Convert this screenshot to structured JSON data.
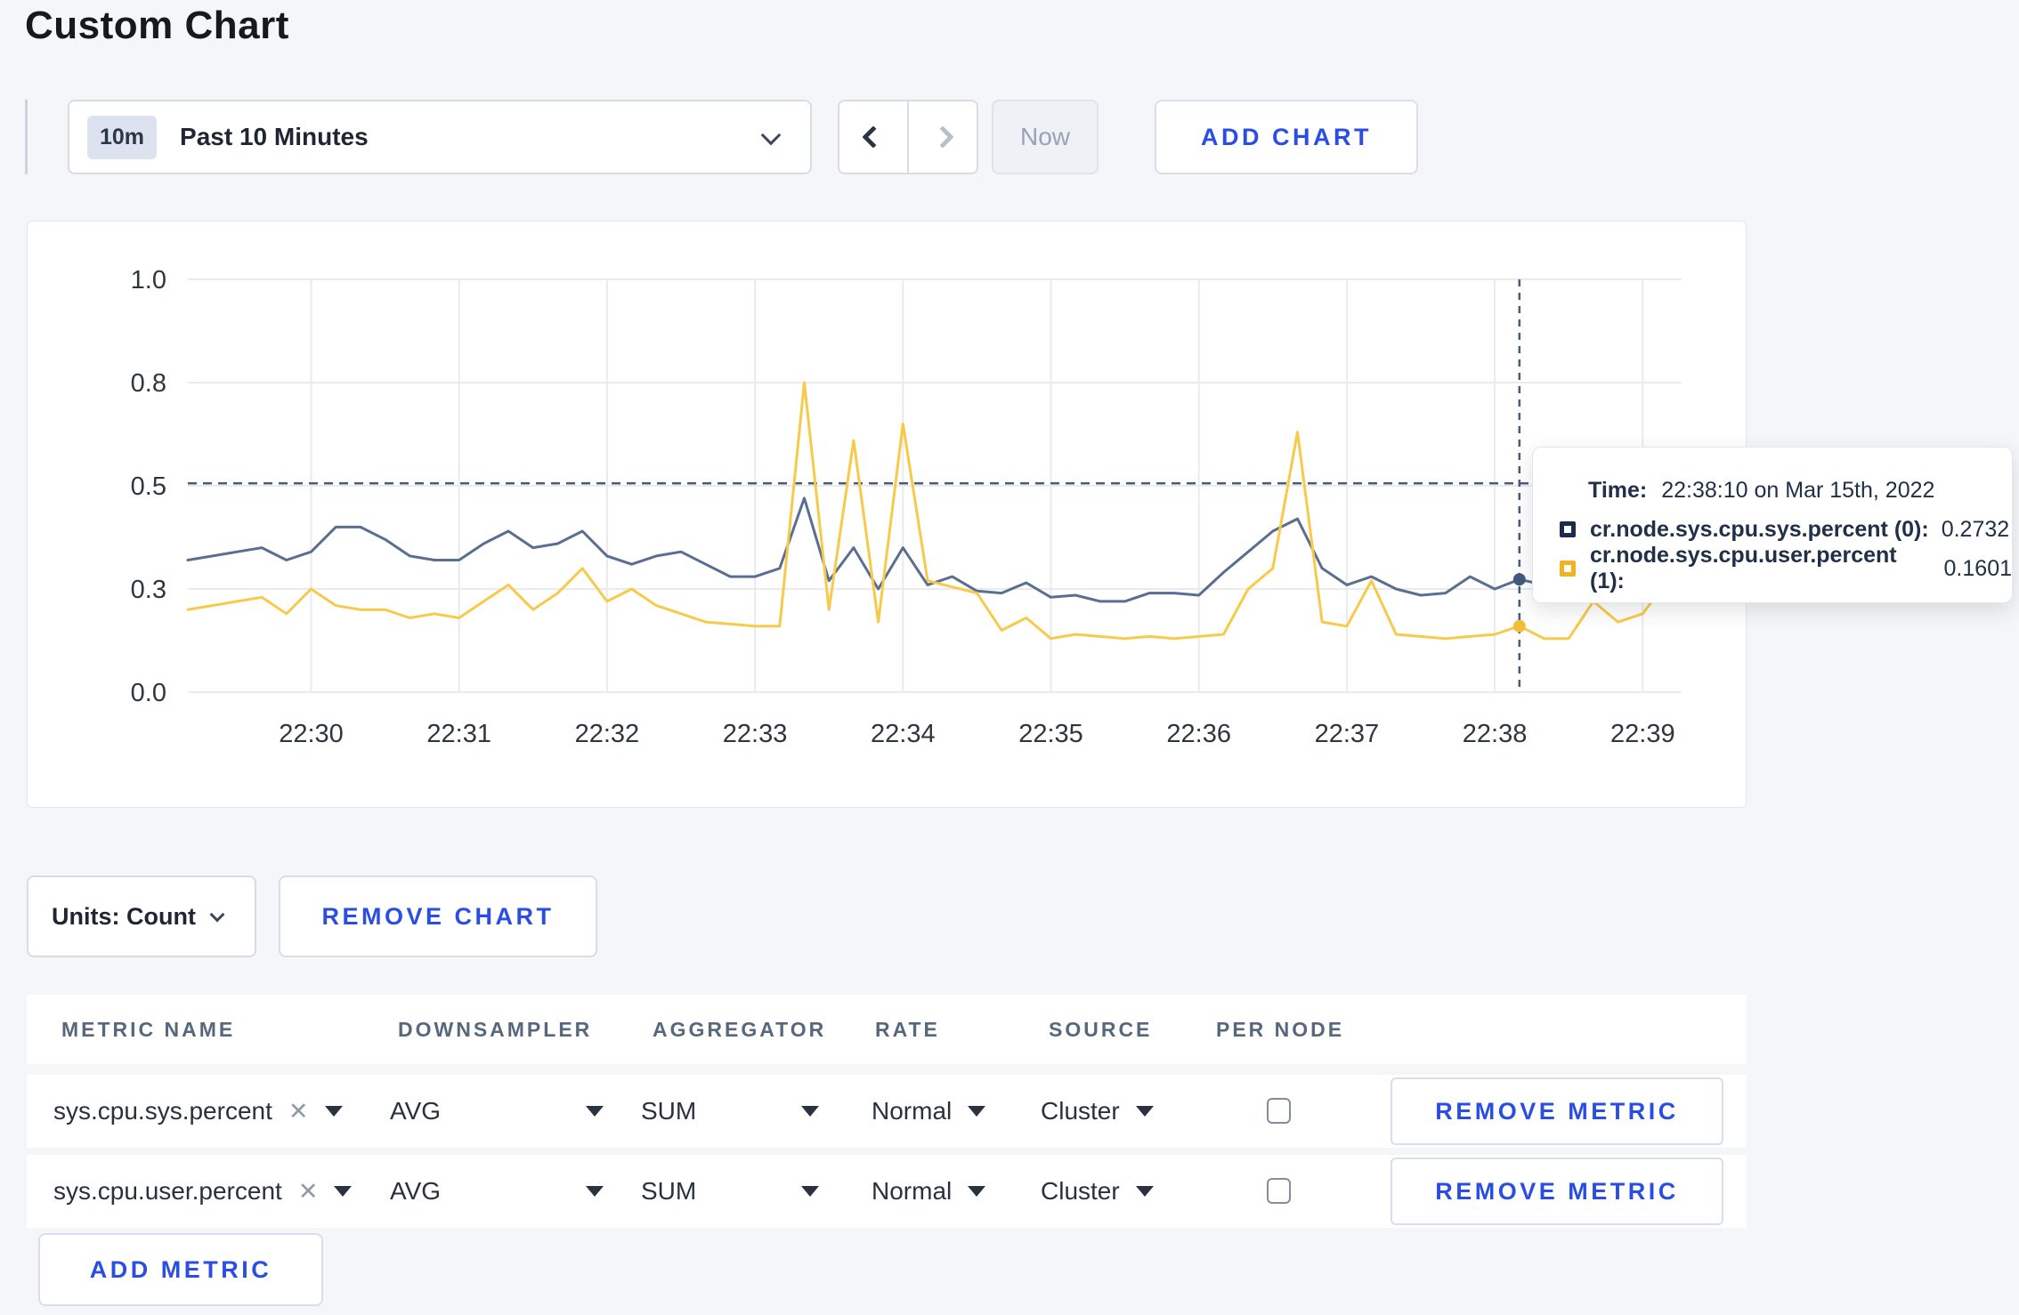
{
  "header": {
    "title": "Custom Chart"
  },
  "toolbar": {
    "time_range": {
      "badge": "10m",
      "label": "Past 10 Minutes"
    },
    "now_label": "Now",
    "add_chart_label": "ADD CHART"
  },
  "chart": {
    "tooltip": {
      "time_label": "Time:",
      "time_value": "22:38:10 on Mar 15th, 2022",
      "series": [
        {
          "label": "cr.node.sys.cpu.sys.percent (0):",
          "value": "0.2732",
          "swatch_color": "#1b2b4a"
        },
        {
          "label": "cr.node.sys.cpu.user.percent (1):",
          "value": "0.1601",
          "swatch_color": "#f0b422"
        }
      ]
    }
  },
  "chart_data": {
    "type": "line",
    "title": "",
    "xlabel": "",
    "ylabel": "",
    "ylim": [
      0,
      1
    ],
    "grid": true,
    "legend_position": "tooltip-overlay",
    "x_start": "22:29:10",
    "sample_interval_seconds": 10,
    "x_ticks": [
      "22:30",
      "22:31",
      "22:32",
      "22:33",
      "22:34",
      "22:35",
      "22:36",
      "22:37",
      "22:38",
      "22:39"
    ],
    "y_ticks": {
      "values": [
        0,
        0.25,
        0.5,
        0.75,
        1.0
      ],
      "labels": [
        "0.0",
        "0.3",
        "0.5",
        "0.8",
        "1.0"
      ]
    },
    "series": [
      {
        "name": "cr.node.sys.cpu.sys.percent",
        "color": "#5a6e91",
        "dot_color": "#44597c",
        "values": [
          0.32,
          0.33,
          0.34,
          0.35,
          0.32,
          0.34,
          0.4,
          0.4,
          0.37,
          0.33,
          0.32,
          0.32,
          0.36,
          0.39,
          0.35,
          0.36,
          0.39,
          0.33,
          0.31,
          0.33,
          0.34,
          0.31,
          0.28,
          0.28,
          0.3,
          0.47,
          0.27,
          0.35,
          0.25,
          0.35,
          0.26,
          0.28,
          0.245,
          0.24,
          0.265,
          0.23,
          0.235,
          0.22,
          0.22,
          0.24,
          0.24,
          0.235,
          0.29,
          0.34,
          0.39,
          0.42,
          0.3,
          0.26,
          0.28,
          0.25,
          0.235,
          0.24,
          0.28,
          0.25,
          0.2732,
          0.26,
          0.25,
          0.27,
          0.29,
          0.3,
          0.3
        ]
      },
      {
        "name": "cr.node.sys.cpu.user.percent",
        "color": "#f8ca4a",
        "dot_color": "#f3bd38",
        "values": [
          0.2,
          0.21,
          0.22,
          0.23,
          0.19,
          0.25,
          0.21,
          0.2,
          0.2,
          0.18,
          0.19,
          0.18,
          0.22,
          0.26,
          0.2,
          0.24,
          0.3,
          0.22,
          0.25,
          0.21,
          0.19,
          0.17,
          0.165,
          0.16,
          0.16,
          0.75,
          0.2,
          0.61,
          0.17,
          0.65,
          0.27,
          0.255,
          0.24,
          0.15,
          0.18,
          0.13,
          0.14,
          0.135,
          0.13,
          0.135,
          0.13,
          0.135,
          0.14,
          0.25,
          0.3,
          0.63,
          0.17,
          0.16,
          0.27,
          0.14,
          0.135,
          0.13,
          0.135,
          0.14,
          0.1601,
          0.13,
          0.13,
          0.22,
          0.17,
          0.19,
          0.27
        ]
      }
    ],
    "threshold_line": {
      "value": 0.506,
      "style": "dashed",
      "color": "#4a5c7c"
    },
    "crosshair": {
      "time": "22:38:10",
      "sample_index": 54,
      "style": "dashed",
      "color": "#4a5c7c",
      "points": [
        {
          "series": 0,
          "value": 0.2732
        },
        {
          "series": 1,
          "value": 0.1601
        }
      ]
    }
  },
  "units_bar": {
    "units_label": "Units: Count",
    "remove_chart_label": "REMOVE CHART"
  },
  "metrics_table": {
    "columns": [
      "METRIC NAME",
      "DOWNSAMPLER",
      "AGGREGATOR",
      "RATE",
      "SOURCE",
      "PER NODE"
    ],
    "rows": [
      {
        "metric": "sys.cpu.sys.percent",
        "downsampler": "AVG",
        "aggregator": "SUM",
        "rate": "Normal",
        "source": "Cluster",
        "per_node_checked": false,
        "remove_label": "REMOVE METRIC"
      },
      {
        "metric": "sys.cpu.user.percent",
        "downsampler": "AVG",
        "aggregator": "SUM",
        "rate": "Normal",
        "source": "Cluster",
        "per_node_checked": false,
        "remove_label": "REMOVE METRIC"
      }
    ],
    "add_metric_label": "ADD METRIC"
  },
  "icons": {
    "clear": "✕"
  }
}
